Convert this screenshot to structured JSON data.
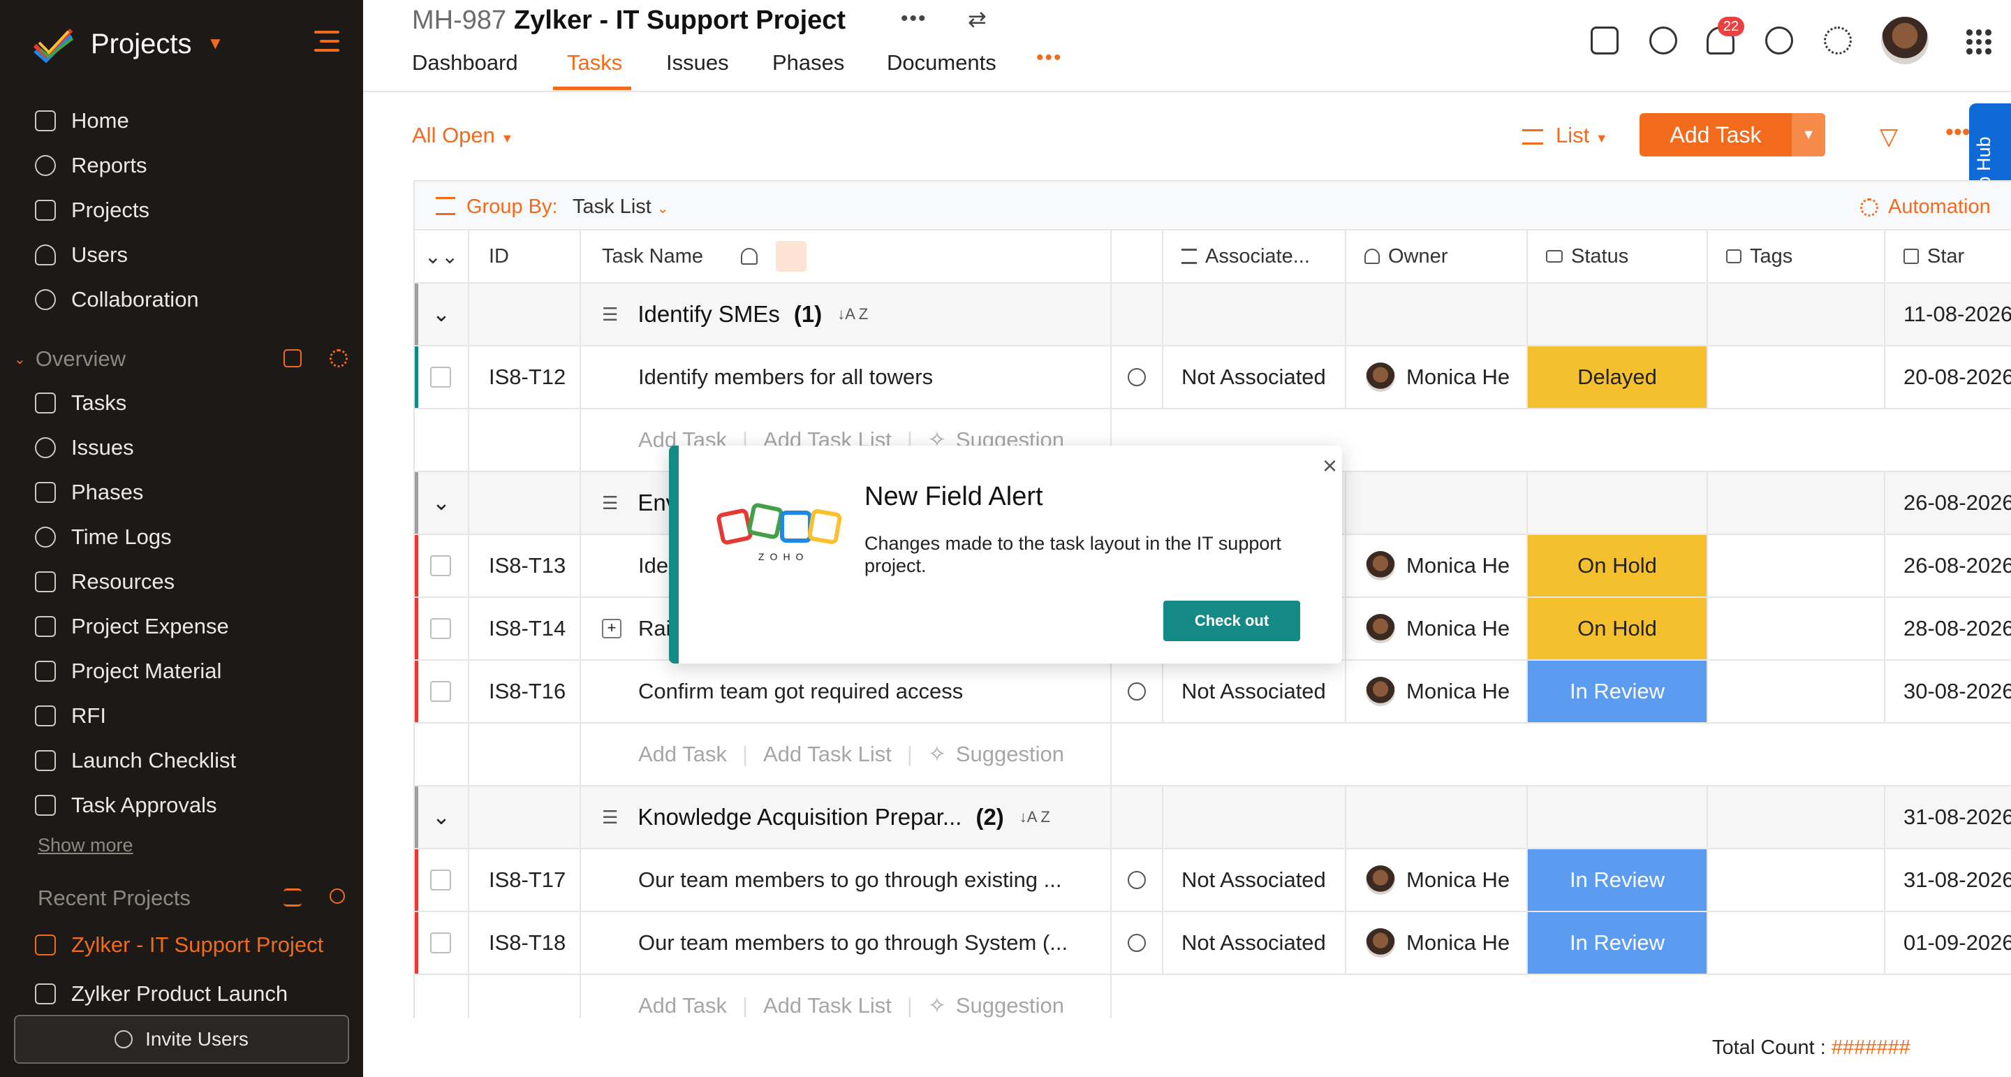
{
  "sidebar": {
    "app_title": "Projects",
    "nav": [
      {
        "label": "Home",
        "icon": "home-icon"
      },
      {
        "label": "Reports",
        "icon": "reports-icon"
      },
      {
        "label": "Projects",
        "icon": "projects-icon"
      },
      {
        "label": "Users",
        "icon": "users-icon"
      },
      {
        "label": "Collaboration",
        "icon": "collaboration-icon"
      }
    ],
    "overview_label": "Overview",
    "overview_items": [
      {
        "label": "Tasks",
        "icon": "tasks-icon"
      },
      {
        "label": "Issues",
        "icon": "issues-icon"
      },
      {
        "label": "Phases",
        "icon": "phases-icon"
      },
      {
        "label": "Time Logs",
        "icon": "timer-icon"
      },
      {
        "label": "Resources",
        "icon": "resources-icon"
      },
      {
        "label": "Project Expense",
        "icon": "expense-icon"
      },
      {
        "label": "Project Material",
        "icon": "material-icon"
      },
      {
        "label": "RFI",
        "icon": "rfi-icon"
      },
      {
        "label": "Launch Checklist",
        "icon": "checklist-icon"
      },
      {
        "label": "Task Approvals",
        "icon": "approvals-icon"
      }
    ],
    "show_more": "Show more",
    "recent_label": "Recent Projects",
    "recent": [
      "Zylker - IT Support Project",
      "Zylker Product Launch"
    ],
    "invite": "Invite Users"
  },
  "header": {
    "project_id": "MH-987",
    "project_name": "Zylker - IT Support Project",
    "tabs": [
      "Dashboard",
      "Tasks",
      "Issues",
      "Phases",
      "Documents"
    ],
    "notification_count": "22"
  },
  "toolbar": {
    "filter": "All Open",
    "view": "List",
    "add_task": "Add Task"
  },
  "help_hub": "Help Hub",
  "table": {
    "group_by_label": "Group By:",
    "group_by_value": "Task List",
    "automation": "Automation",
    "columns": [
      "ID",
      "Task Name",
      "Associate...",
      "Owner",
      "Status",
      "Tags",
      "Star"
    ],
    "add_task": "Add Task",
    "add_task_list": "Add Task List",
    "suggestion": "Suggestion",
    "groups": [
      {
        "name": "Identify SMEs",
        "count": "(1)",
        "date": "11-08-2026"
      },
      {
        "name": "Env",
        "date": "26-08-2026"
      },
      {
        "name": "Knowledge Acquisition Prepar...",
        "count": "(2)",
        "date": "31-08-2026"
      }
    ],
    "rows": [
      {
        "id": "IS8-T12",
        "name": "Identify members for all towers",
        "assoc": "Not Associated",
        "owner": "Monica He",
        "status": "Delayed",
        "date": "20-08-2026"
      },
      {
        "id": "IS8-T13",
        "name": "Ide",
        "owner": "Monica He",
        "status": "On Hold",
        "date": "26-08-2026"
      },
      {
        "id": "IS8-T14",
        "name": "Rai",
        "owner": "Monica He",
        "status": "On Hold",
        "date": "28-08-2026"
      },
      {
        "id": "IS8-T16",
        "name": "Confirm team got required access",
        "assoc": "Not Associated",
        "owner": "Monica He",
        "status": "In Review",
        "date": "30-08-2026"
      },
      {
        "id": "IS8-T17",
        "name": "Our team members to go through existing ...",
        "assoc": "Not Associated",
        "owner": "Monica He",
        "status": "In Review",
        "date": "31-08-2026"
      },
      {
        "id": "IS8-T18",
        "name": "Our team members to go through System (...",
        "assoc": "Not Associated",
        "owner": "Monica He",
        "status": "In Review",
        "date": "01-09-2026"
      }
    ]
  },
  "footer": {
    "total_label": "Total Count :",
    "total_value": "#######"
  },
  "modal": {
    "title": "New Field Alert",
    "body": "Changes made to the task layout in the IT support project.",
    "button": "Check out",
    "logo_text": "ZOHO"
  },
  "colors": {
    "accent": "#f26b1d",
    "teal": "#138a85",
    "delayed": "#f5c02e",
    "on_hold": "#f5c02e",
    "in_review": "#5b9cf0"
  }
}
